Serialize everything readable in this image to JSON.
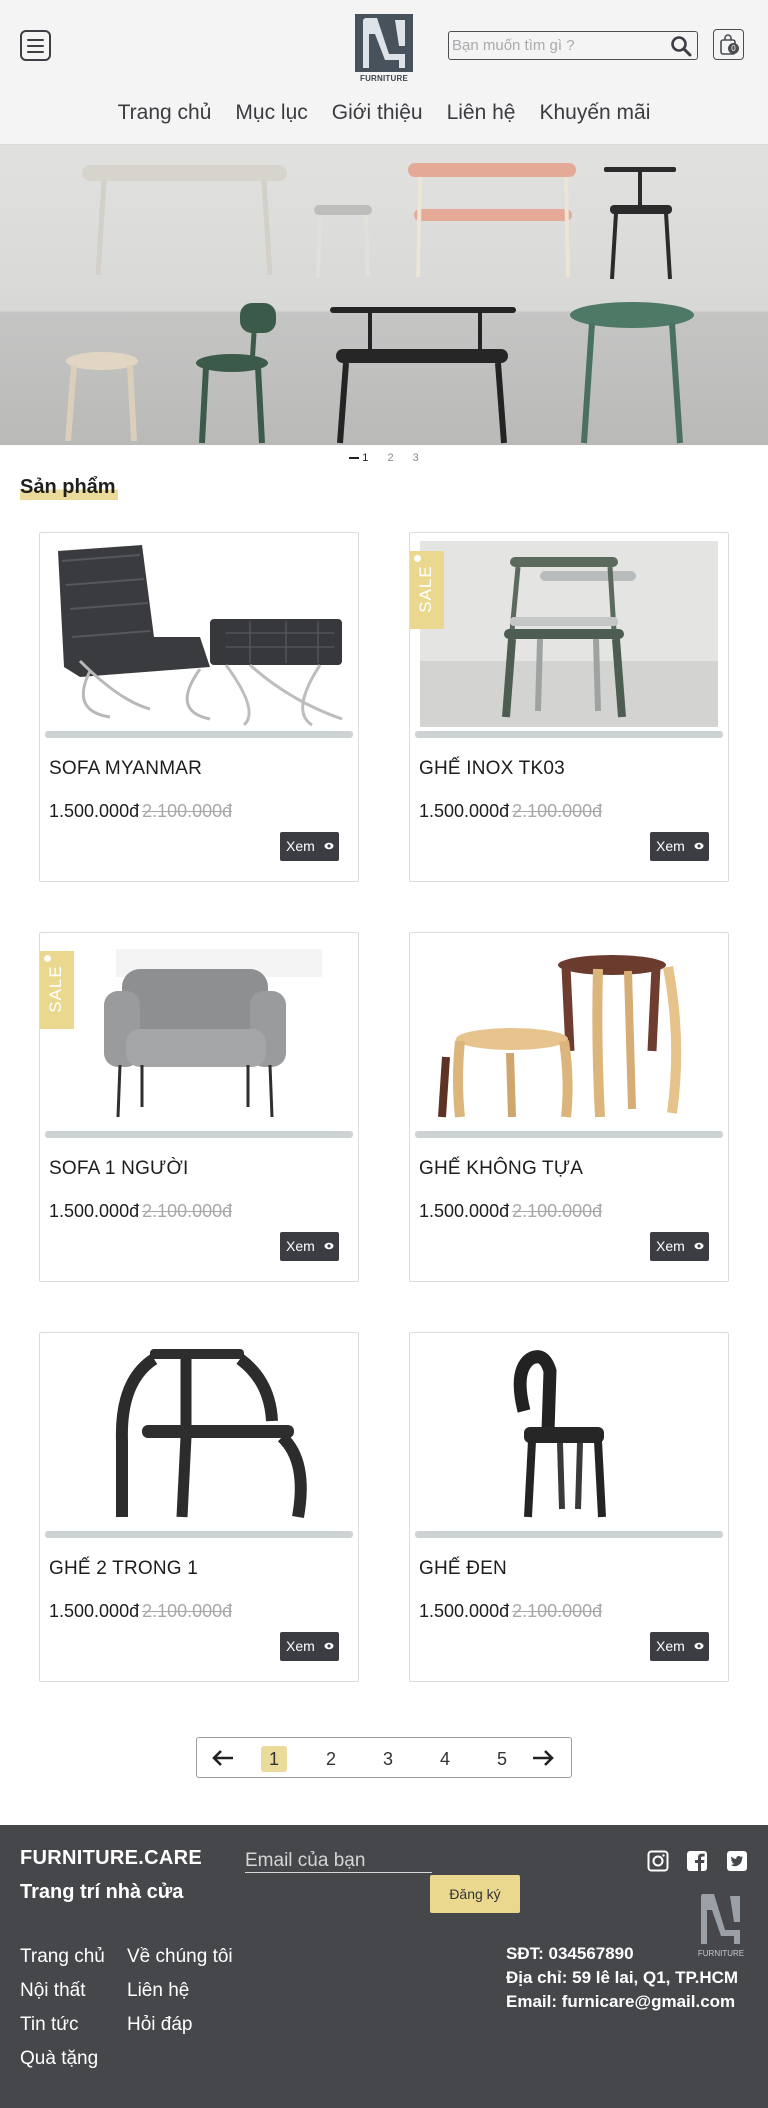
{
  "header": {
    "logo_text": "FURNITURE",
    "search_placeholder": "Bạn muốn tìm gì ?",
    "cart_count": "0",
    "nav": [
      "Trang chủ",
      "Mục lục",
      "Giới thiệu",
      "Liên hệ",
      "Khuyến mãi"
    ]
  },
  "slider": {
    "dots": [
      "1",
      "2",
      "3"
    ],
    "active_index": 1
  },
  "products": {
    "section_title": "Sản phẩm",
    "sale_label": "SALE",
    "view_label": "Xem",
    "items": [
      {
        "name": "SOFA MYANMAR",
        "price": "1.500.000đ",
        "old_price": "2.100.000đ",
        "sale": false
      },
      {
        "name": "GHẾ INOX TK03",
        "price": "1.500.000đ",
        "old_price": "2.100.000đ",
        "sale": true
      },
      {
        "name": "SOFA 1 NGƯỜI",
        "price": "1.500.000đ",
        "old_price": "2.100.000đ",
        "sale": true
      },
      {
        "name": "GHẾ KHÔNG TỰA",
        "price": "1.500.000đ",
        "old_price": "2.100.000đ",
        "sale": false
      },
      {
        "name": "GHẾ 2 TRONG 1",
        "price": "1.500.000đ",
        "old_price": "2.100.000đ",
        "sale": false
      },
      {
        "name": "GHẾ ĐEN",
        "price": "1.500.000đ",
        "old_price": "2.100.000đ",
        "sale": false
      }
    ]
  },
  "pagination": {
    "pages": [
      "1",
      "2",
      "3",
      "4",
      "5"
    ],
    "current": "1"
  },
  "footer": {
    "brand": "FURNITURE.CARE",
    "tagline": "Trang trí nhà cửa",
    "email_placeholder": "Email của bạn",
    "subscribe_label": "Đăng ký",
    "logo_text": "FURNITURE",
    "links_col1": [
      "Trang chủ",
      "Nội thất",
      "Tin tức",
      "Quà tặng"
    ],
    "links_col2": [
      "Về chúng tôi",
      "Liên hệ",
      "Hỏi đáp"
    ],
    "phone": "SĐT: 034567890",
    "address": "Địa chỉ: 59 lê lai, Q1, TP.HCM",
    "email": "Email: furnicare@gmail.com"
  },
  "colors": {
    "accent": "#eadb9a",
    "dark": "#45474b",
    "button": "#3c3d42"
  }
}
